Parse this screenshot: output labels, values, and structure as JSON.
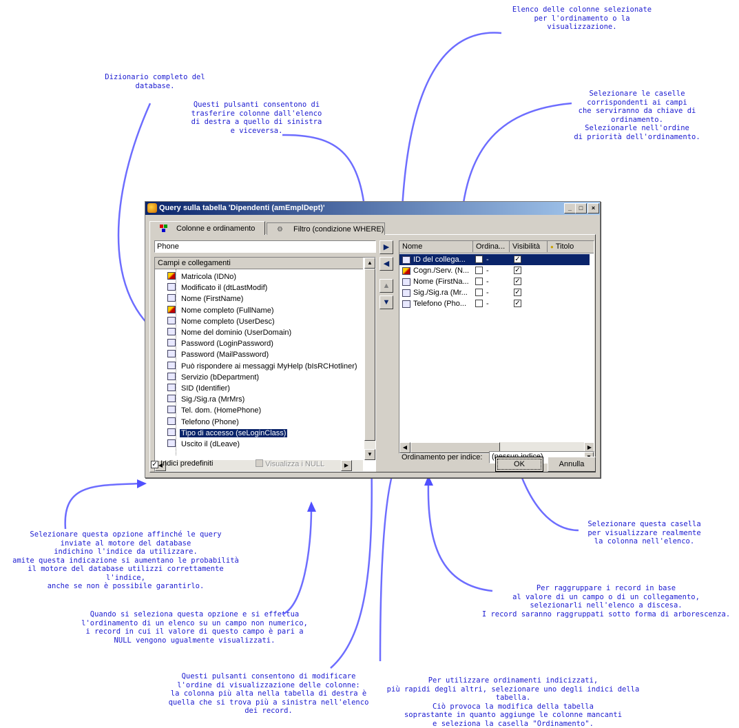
{
  "dialog": {
    "title": "Query sulla tabella 'Dipendenti (amEmplDept)'",
    "window_buttons": [
      "_",
      "□",
      "×"
    ],
    "tabs": [
      {
        "label": "Colonne e ordinamento",
        "active": true
      },
      {
        "label": "Filtro (condizione WHERE)",
        "active": false
      }
    ],
    "search_value": "Phone",
    "tree_header": "Campi e collegamenti",
    "tree_items": [
      {
        "label": "Matricola (IDNo)",
        "icon": "link-icon"
      },
      {
        "label": "Modificato il (dtLastModif)",
        "icon": "field-icon"
      },
      {
        "label": "Nome (FirstName)",
        "icon": "field-icon"
      },
      {
        "label": "Nome completo (FullName)",
        "icon": "link-icon"
      },
      {
        "label": "Nome completo (UserDesc)",
        "icon": "field-icon"
      },
      {
        "label": "Nome del dominio (UserDomain)",
        "icon": "field-icon"
      },
      {
        "label": "Password (LoginPassword)",
        "icon": "field-icon"
      },
      {
        "label": "Password (MailPassword)",
        "icon": "field-icon"
      },
      {
        "label": "Può rispondere ai messaggi MyHelp (bIsRCHotliner)",
        "icon": "field-icon"
      },
      {
        "label": "Servizio (bDepartment)",
        "icon": "field-icon"
      },
      {
        "label": "SID (Identifier)",
        "icon": "field-icon"
      },
      {
        "label": "Sig./Sig.ra (MrMrs)",
        "icon": "field-icon"
      },
      {
        "label": "Tel. dom. (HomePhone)",
        "icon": "field-icon"
      },
      {
        "label": "Telefono (Phone)",
        "icon": "field-icon"
      },
      {
        "label": "Tipo di accesso (seLoginClass)",
        "icon": "field-icon",
        "selected": true
      },
      {
        "label": "Uscito il (dLeave)",
        "icon": "field-icon"
      }
    ],
    "columns_header": [
      "Nome",
      "Ordina...",
      "Visibilità",
      "Titolo"
    ],
    "columns": [
      {
        "name": "ID del collega...",
        "sort": "-",
        "visible": true,
        "selected": true
      },
      {
        "name": "Cogn./Serv. (N...",
        "sort": "-",
        "visible": true
      },
      {
        "name": "Nome (FirstNa...",
        "sort": "-",
        "visible": true
      },
      {
        "name": "Sig./Sig.ra (Mr...",
        "sort": "-",
        "visible": true
      },
      {
        "name": "Telefono (Pho...",
        "sort": "-",
        "visible": true
      }
    ],
    "index_sort_label": "Ordinamento per indice:",
    "index_sort_value": "(nessun indice)",
    "default_indexes_label": "Indici predefiniti",
    "default_indexes_checked": true,
    "show_null_label": "Visualizza i NULL",
    "show_null_enabled": false,
    "ok_label": "OK",
    "cancel_label": "Annulla"
  },
  "annotations": {
    "selected_columns": "Elenco delle colonne selezionate\nper l'ordinamento o la\nvisualizzazione.",
    "dictionary": "Dizionario completo del\ndatabase.",
    "transfer_buttons": "Questi pulsanti consentono di\ntrasferire colonne dall'elenco\ndi destra a quello di sinistra\ne viceversa.",
    "sort_keys": "Selezionare le caselle\ncorrispondenti ai campi\nche serviranno da chiave di\nordinamento.\nSelezionarle nell'ordine\ndi priorità dell'ordinamento.",
    "visibility": "Selezionare questa casella\nper visualizzare realmente\nla colonna nell'elenco.",
    "default_indexes": "Selezionare questa opzione affinché le query\ninviate al motore del database\nindichino l'indice da utilizzare.\namite questa indicazione si aumentano le probabilità\nil motore del database utilizzi correttamente l'indice,\nanche se non è possibile garantirlo.",
    "show_null": "Quando si seleziona questa opzione e si effettua\nl'ordinamento di un elenco su un campo non numerico,\ni record in cui il valore di questo campo è pari a\nNULL vengono ugualmente visualizzati.",
    "grouping": "Per raggruppare i record in base\nal valore di un campo o di un collegamento,\nselezionarli nell'elenco a discesa.\nI record saranno raggruppati sotto forma di arborescenza.",
    "order_buttons": "Questi pulsanti consentono di modificare\nl'ordine di visualizzazione delle colonne:\nla colonna più alta nella tabella di destra è\nquella che si trova più a sinistra nell'elenco\ndei record.",
    "index_sort": "Per utilizzare ordinamenti indicizzati,\npiù rapidi degli altri, selezionare uno degli indici della tabella.\nCiò provoca la modifica della tabella\nsoprastante in quanto aggiunge le colonne mancanti\ne seleziona la casella \"Ordinamento\"."
  },
  "colors": {
    "accent": "#0a246a",
    "annotation_text": "#1a1ad0",
    "arrow": "#6d6dff",
    "dialog_bg": "#d4d0c8"
  }
}
